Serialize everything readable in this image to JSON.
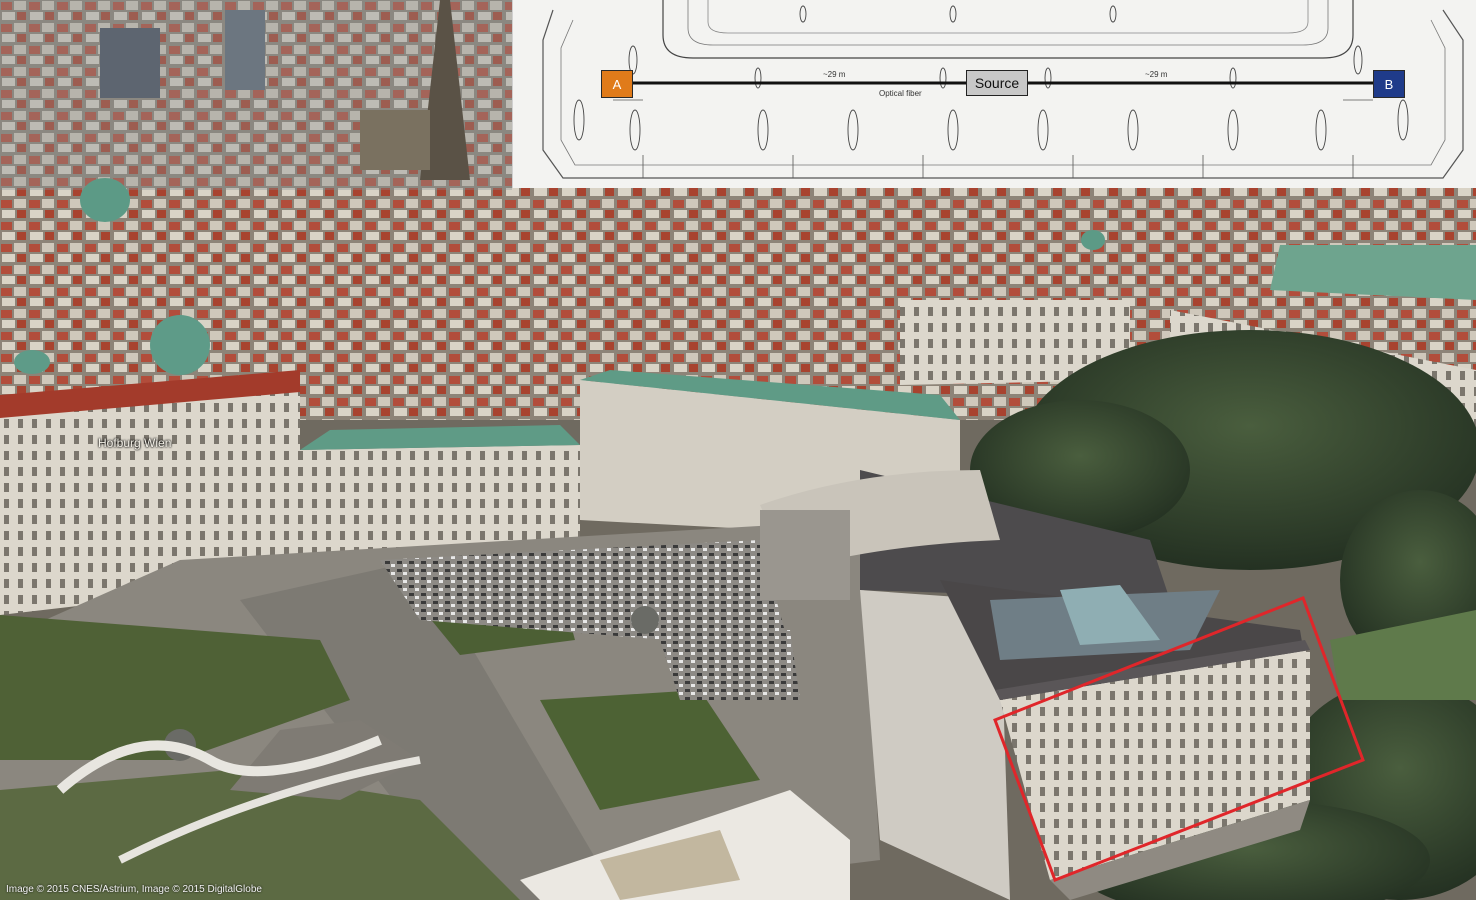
{
  "inset": {
    "point_a": "A",
    "point_b": "B",
    "source": "Source",
    "distance_left": "~29 m",
    "distance_right": "~29 m",
    "fiber_label": "Optical fiber",
    "color_a": "#e07b1a",
    "color_b": "#1f3b8a"
  },
  "map": {
    "place_label": "Hofburg Wien",
    "credit": "Image © 2015 CNES/Astrium, Image © 2015 DigitalGlobe",
    "highlight_color": "#e0262a"
  }
}
